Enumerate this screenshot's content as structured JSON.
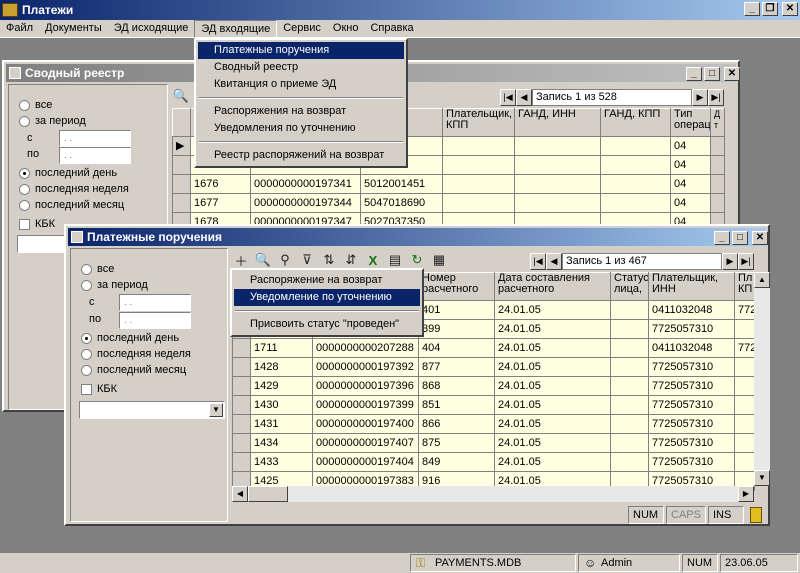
{
  "app": {
    "title": "Платежи"
  },
  "menubar": [
    "Файл",
    "Документы",
    "ЭД исходящие",
    "ЭД входящие",
    "Сервис",
    "Окно",
    "Справка"
  ],
  "dropdown_menu": {
    "items": [
      "Платежные поручения",
      "Сводный реестр",
      "Квитанция о приеме ЭД",
      "Распоряжения на возврат",
      "Уведомления по уточнению",
      "Реестр распоряжений на возврат"
    ]
  },
  "registry_window": {
    "title": "Сводный реестр",
    "filter": {
      "all": "все",
      "period": "за период",
      "from": "с",
      "to": "по",
      "date_placeholder": ". .",
      "last_day": "последний день",
      "last_week": "последняя неделя",
      "last_month": "последний месяц",
      "kbk": "КБК"
    },
    "nav_text": "Запись 1 из 528",
    "columns": [
      "i",
      "",
      "Плательщик, КПП",
      "Плательщик, КПП",
      "ГАНД, ИНН",
      "ГАНД, КПП",
      "Тип операц",
      "Д т"
    ],
    "col3_header": "щик,",
    "col3b_header": "Плательщик, КПП",
    "rows": [
      {
        "a": "",
        "b": "",
        "c": "88",
        "d": "04"
      },
      {
        "a": "",
        "b": "",
        "c": "49",
        "d": "04"
      },
      {
        "a": "1676",
        "b": "0000000000197341",
        "c": "5012001451",
        "d": "04"
      },
      {
        "a": "1677",
        "b": "0000000000197344",
        "c": "5047018690",
        "d": "04"
      },
      {
        "a": "1678",
        "b": "0000000000197347",
        "c": "5027037350",
        "d": "04"
      }
    ]
  },
  "payments_window": {
    "title": "Платежные поручения",
    "filter": {
      "all": "все",
      "period": "за период",
      "from": "с",
      "to": "по",
      "date_placeholder": ". .",
      "last_day": "последний день",
      "last_week": "последняя неделя",
      "last_month": "последний месяц",
      "kbk": "КБК"
    },
    "nav_text": "Запись 1 из 467",
    "columns": [
      "Номер расчетного",
      "Дата составления расчетного",
      "Статус лица,",
      "Плательщик, ИНН",
      "Пл КП"
    ],
    "rows": [
      {
        "id": "",
        "num": "",
        "n2": "401",
        "date": "24.01.05",
        "inn": "0411032048",
        "kpp": "772"
      },
      {
        "id": "",
        "num": "",
        "n2": "399",
        "date": "24.01.05",
        "inn": "7725057310",
        "kpp": ""
      },
      {
        "id": "1711",
        "num": "0000000000207288",
        "n2": "404",
        "date": "24.01.05",
        "inn": "0411032048",
        "kpp": "772"
      },
      {
        "id": "1428",
        "num": "0000000000197392",
        "n2": "877",
        "date": "24.01.05",
        "inn": "7725057310",
        "kpp": ""
      },
      {
        "id": "1429",
        "num": "0000000000197396",
        "n2": "868",
        "date": "24.01.05",
        "inn": "7725057310",
        "kpp": ""
      },
      {
        "id": "1430",
        "num": "0000000000197399",
        "n2": "851",
        "date": "24.01.05",
        "inn": "7725057310",
        "kpp": ""
      },
      {
        "id": "1431",
        "num": "0000000000197400",
        "n2": "866",
        "date": "24.01.05",
        "inn": "7725057310",
        "kpp": ""
      },
      {
        "id": "1434",
        "num": "0000000000197407",
        "n2": "875",
        "date": "24.01.05",
        "inn": "7725057310",
        "kpp": ""
      },
      {
        "id": "1433",
        "num": "0000000000197404",
        "n2": "849",
        "date": "24.01.05",
        "inn": "7725057310",
        "kpp": ""
      },
      {
        "id": "1425",
        "num": "0000000000197383",
        "n2": "916",
        "date": "24.01.05",
        "inn": "7725057310",
        "kpp": ""
      }
    ],
    "context_menu": [
      "Распоряжение на возврат",
      "Уведомление по уточнению",
      "Присвоить статус \"проведен\""
    ],
    "status": {
      "num": "NUM",
      "caps": "CAPS",
      "ins": "INS"
    }
  },
  "statusbar": {
    "db": "PAYMENTS.MDB",
    "user": "Admin",
    "num": "NUM",
    "date": "23.06.05"
  }
}
